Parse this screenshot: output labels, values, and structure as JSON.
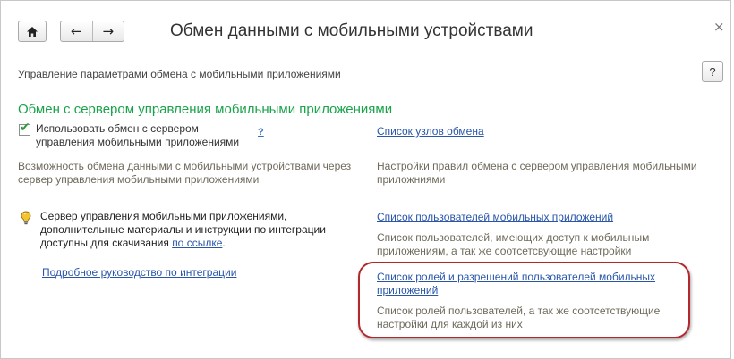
{
  "window": {
    "title": "Обмен данными с мобильными устройствами",
    "close_glyph": "×",
    "home_icon": "home-icon",
    "back_glyph": "←",
    "forward_glyph": "→"
  },
  "header": {
    "subtitle": "Управление параметрами обмена с мобильными приложениями",
    "help_label": "?"
  },
  "section": {
    "title": "Обмен с сервером управления мобильными приложениями",
    "title_color": "#1aa34a"
  },
  "exchange": {
    "checkbox_checked": true,
    "checkbox_label": "Использовать обмен с сервером управления мобильными приложениями",
    "help_link": "?",
    "description": "Возможность обмена данными с мобильными устройствами через сервер управления мобильными приложениями"
  },
  "right_column": {
    "nodes_link": "Список узлов обмена",
    "nodes_desc": "Настройки правил обмена с сервером управления мобильными приложниями",
    "users_link": "Список пользователей мобильных приложений",
    "users_desc": "Список пользователей, имеющих доступ к мобильным приложениям, а так же соотсетсвующие настройки",
    "roles_link": "Список ролей и разрешений пользователей мобильных приложений",
    "roles_desc": "Список ролей пользователей,  а так же соотсетствующие настройки для каждой из них"
  },
  "info": {
    "text": "Сервер управления мобильными приложениями, дополнительные материалы и инструкции по интеграции доступны для скачивания ",
    "link": "по ссылке",
    "suffix": ".",
    "guide_link": "Подробное руководство по интеграции"
  },
  "colors": {
    "link": "#2a56a8",
    "highlight": "#b3282d"
  }
}
